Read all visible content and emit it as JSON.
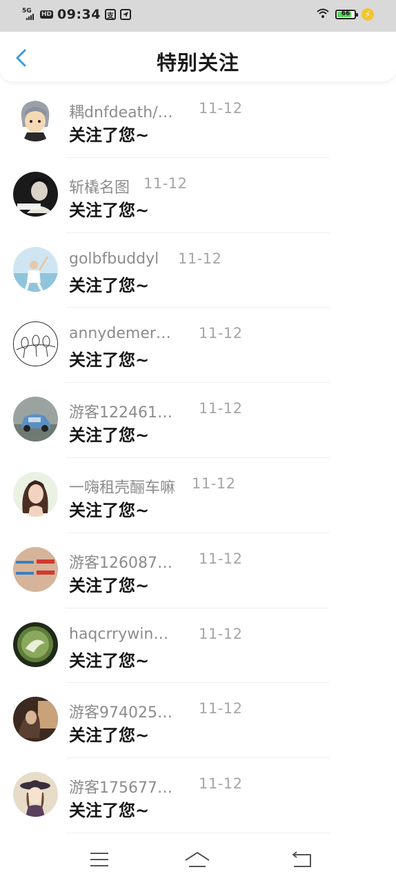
{
  "status_bar": {
    "network": "5G",
    "hd_badge": "HD",
    "time": "09:34",
    "app_icon_1": "支",
    "app_icon_2": "send-icon",
    "battery": "66",
    "charging": "bolt-icon"
  },
  "header": {
    "back_icon": "chevron-left-icon",
    "title": "特别关注",
    "accent": "#3a9ad9"
  },
  "items": [
    {
      "name": "耦dnfdeath/…",
      "date": "11-12",
      "message": "关注了您~"
    },
    {
      "name": "斩橇名图",
      "date": "11-12",
      "message": "关注了您~"
    },
    {
      "name": "golbfbuddyl",
      "date": "11-12",
      "message": "关注了您~"
    },
    {
      "name": "annydemer…",
      "date": "11-12",
      "message": "关注了您~"
    },
    {
      "name": "游客122461…",
      "date": "11-12",
      "message": "关注了您~"
    },
    {
      "name": "一嗨租壳酾车嘛",
      "date": "11-12",
      "message": "关注了您~"
    },
    {
      "name": "游客126087…",
      "date": "11-12",
      "message": "关注了您~"
    },
    {
      "name": "haqcrrywin…",
      "date": "11-12",
      "message": "关注了您~"
    },
    {
      "name": "游客974025…",
      "date": "11-12",
      "message": "关注了您~"
    },
    {
      "name": "游客175677…",
      "date": "11-12",
      "message": "关注了您~"
    }
  ],
  "nav": {
    "menu_icon": "menu-icon",
    "home_icon": "home-icon",
    "back_icon": "back-icon"
  }
}
